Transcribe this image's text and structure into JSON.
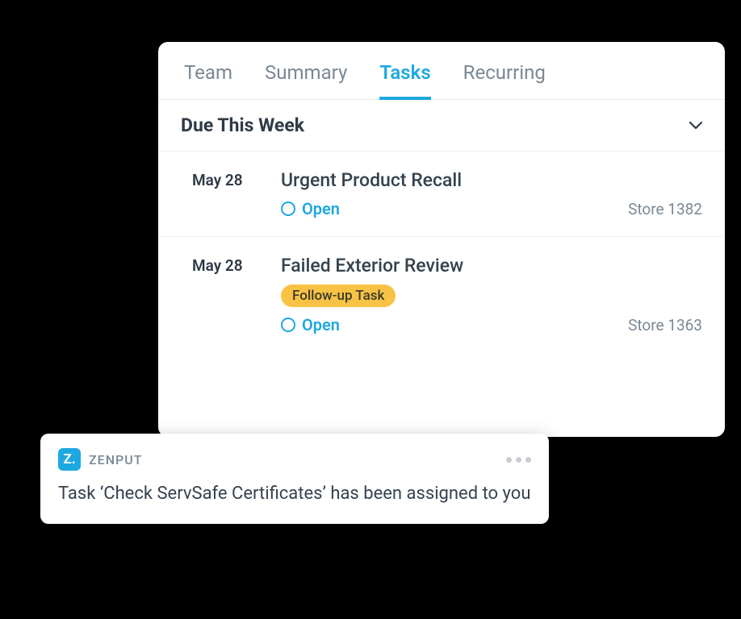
{
  "tabs": {
    "team": "Team",
    "summary": "Summary",
    "tasks": "Tasks",
    "recurring": "Recurring",
    "active": "tasks"
  },
  "section": {
    "title": "Due This Week"
  },
  "tasks": [
    {
      "date": "May 28",
      "title": "Urgent Product Recall",
      "status": "Open",
      "store": "Store 1382",
      "badge": null
    },
    {
      "date": "May 28",
      "title": "Failed Exterior Review",
      "status": "Open",
      "store": "Store 1363",
      "badge": "Follow-up Task"
    }
  ],
  "notification": {
    "app_icon_letter": "Z.",
    "app_name": "ZENPUT",
    "message": "Task ‘Check ServSafe Certificates’ has been assigned to you"
  },
  "colors": {
    "accent": "#1ea8e0",
    "badge_bg": "#f8c245"
  }
}
